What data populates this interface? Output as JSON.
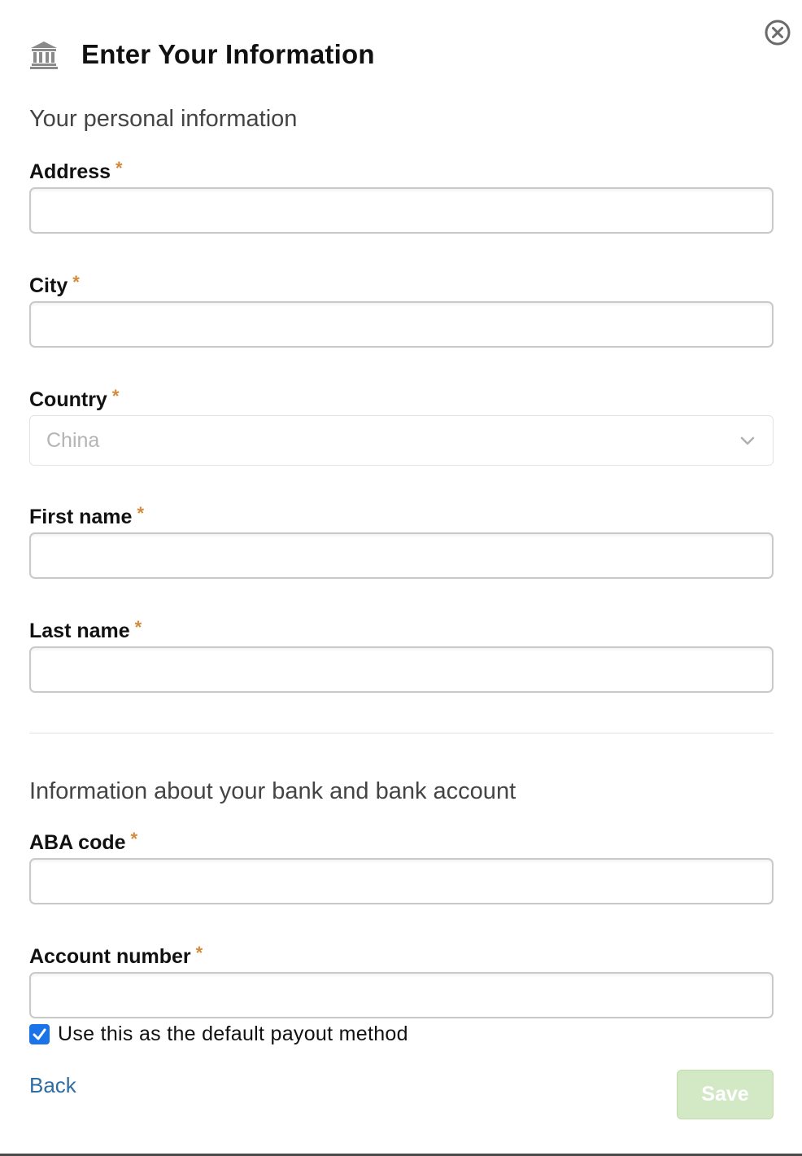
{
  "header": {
    "title": "Enter Your Information",
    "icon": "bank-icon",
    "close_icon": "close-icon"
  },
  "personal": {
    "section_title": "Your personal information",
    "address": {
      "label": "Address",
      "required_mark": "*",
      "value": ""
    },
    "city": {
      "label": "City",
      "required_mark": "*",
      "value": ""
    },
    "country": {
      "label": "Country",
      "required_mark": "*",
      "selected": "China"
    },
    "first_name": {
      "label": "First name",
      "required_mark": "*",
      "value": ""
    },
    "last_name": {
      "label": "Last name",
      "required_mark": "*",
      "value": ""
    }
  },
  "bank": {
    "section_title": "Information about your bank and bank account",
    "aba_code": {
      "label": "ABA code",
      "required_mark": "*",
      "value": ""
    },
    "account_number": {
      "label": "Account number",
      "required_mark": "*",
      "value": ""
    }
  },
  "default_payout": {
    "label": "Use this as the default payout method",
    "checked": true
  },
  "footer": {
    "back_label": "Back",
    "save_label": "Save"
  },
  "colors": {
    "required": "#d48a3a",
    "link": "#2e6da4",
    "save_disabled": "#d3e8c5",
    "checkbox": "#1a73e8"
  }
}
